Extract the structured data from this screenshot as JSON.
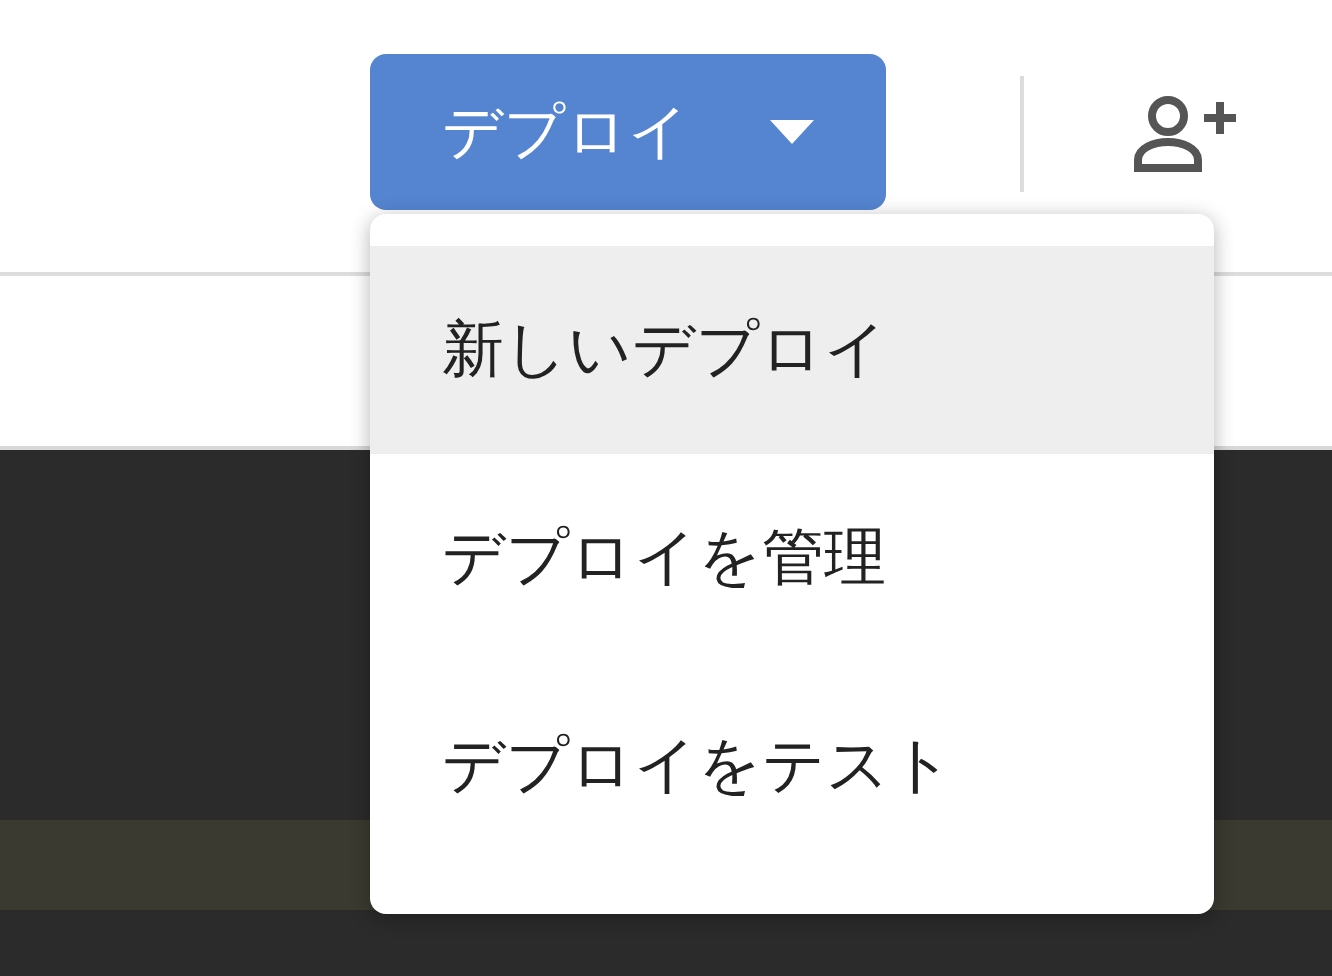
{
  "toolbar": {
    "deploy_button": {
      "label": "デプロイ"
    }
  },
  "deploy_menu": {
    "items": [
      {
        "label": "新しいデプロイ",
        "selected": true
      },
      {
        "label": "デプロイを管理",
        "selected": false
      },
      {
        "label": "デプロイをテスト",
        "selected": false
      }
    ]
  }
}
